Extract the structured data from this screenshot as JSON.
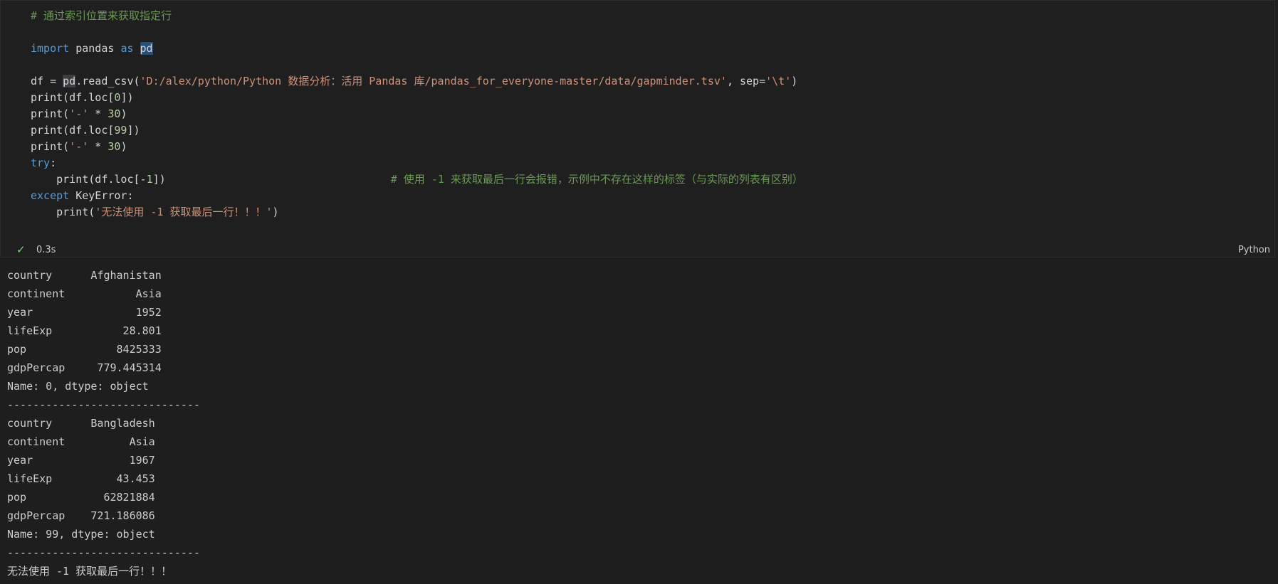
{
  "code_lines": [
    [
      {
        "t": "# 通过索引位置来获取指定行",
        "c": "comment"
      }
    ],
    [],
    [
      {
        "t": "import",
        "c": "kw"
      },
      {
        "t": " pandas ",
        "c": "plain"
      },
      {
        "t": "as",
        "c": "kw"
      },
      {
        "t": " ",
        "c": "plain"
      },
      {
        "t": "pd",
        "c": "sel"
      }
    ],
    [],
    [
      {
        "t": "df = ",
        "c": "plain"
      },
      {
        "t": "pd",
        "c": "word"
      },
      {
        "t": ".read_csv(",
        "c": "plain"
      },
      {
        "t": "'D:/alex/python/Python 数据分析：活用 Pandas 库/pandas_for_everyone-master/data/gapminder.tsv'",
        "c": "str"
      },
      {
        "t": ", sep=",
        "c": "plain"
      },
      {
        "t": "'\\t'",
        "c": "str"
      },
      {
        "t": ")",
        "c": "plain"
      }
    ],
    [
      {
        "t": "print(df.loc[",
        "c": "plain"
      },
      {
        "t": "0",
        "c": "num"
      },
      {
        "t": "])",
        "c": "plain"
      }
    ],
    [
      {
        "t": "print(",
        "c": "plain"
      },
      {
        "t": "'-'",
        "c": "str"
      },
      {
        "t": " * ",
        "c": "plain"
      },
      {
        "t": "30",
        "c": "num"
      },
      {
        "t": ")",
        "c": "plain"
      }
    ],
    [
      {
        "t": "print(df.loc[",
        "c": "plain"
      },
      {
        "t": "99",
        "c": "num"
      },
      {
        "t": "])",
        "c": "plain"
      }
    ],
    [
      {
        "t": "print(",
        "c": "plain"
      },
      {
        "t": "'-'",
        "c": "str"
      },
      {
        "t": " * ",
        "c": "plain"
      },
      {
        "t": "30",
        "c": "num"
      },
      {
        "t": ")",
        "c": "plain"
      }
    ],
    [
      {
        "t": "try",
        "c": "kw"
      },
      {
        "t": ":",
        "c": "plain"
      }
    ],
    [
      {
        "t": "    print(df.loc[-",
        "c": "plain"
      },
      {
        "t": "1",
        "c": "num"
      },
      {
        "t": "])                                   ",
        "c": "plain"
      },
      {
        "t": "# 使用 -1 来获取最后一行会报错，示例中不存在这样的标签（与实际的列表有区别）",
        "c": "comment"
      }
    ],
    [
      {
        "t": "except",
        "c": "kw"
      },
      {
        "t": " KeyError:",
        "c": "plain"
      }
    ],
    [
      {
        "t": "    print(",
        "c": "plain"
      },
      {
        "t": "'无法使用 -1 获取最后一行！！！'",
        "c": "str"
      },
      {
        "t": ")",
        "c": "plain"
      }
    ]
  ],
  "status": {
    "check_icon": "✓",
    "exec_time": "0.3s",
    "language": "Python"
  },
  "output_lines": [
    "country      Afghanistan",
    "continent           Asia",
    "year                1952",
    "lifeExp           28.801",
    "pop              8425333",
    "gdpPercap     779.445314",
    "Name: 0, dtype: object",
    "------------------------------",
    "country      Bangladesh",
    "continent          Asia",
    "year               1967",
    "lifeExp          43.453",
    "pop            62821884",
    "gdpPercap    721.186086",
    "Name: 99, dtype: object",
    "------------------------------",
    "无法使用 -1 获取最后一行！！！"
  ],
  "colors": {
    "comment": "#6a9955",
    "keyword": "#569cd6",
    "string": "#ce9178",
    "number": "#b5cea8",
    "check": "#89d185"
  }
}
